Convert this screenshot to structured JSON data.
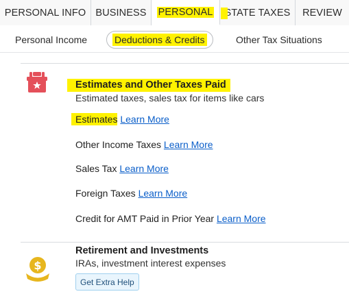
{
  "top_tabs": [
    {
      "label": "PERSONAL INFO"
    },
    {
      "label": "BUSINESS"
    },
    {
      "label": "PERSONAL"
    },
    {
      "label": "STATE TAXES"
    },
    {
      "label": "REVIEW"
    }
  ],
  "sub_tabs": [
    {
      "label": "Personal Income"
    },
    {
      "label": "Deductions & Credits"
    },
    {
      "label": "Other Tax Situations"
    }
  ],
  "section1": {
    "title": "Estimates and Other Taxes Paid",
    "description": "Estimated taxes, sales tax for items like cars",
    "items": [
      {
        "label": "Estimates",
        "link": "Learn More"
      },
      {
        "label": "Other Income Taxes",
        "link": "Learn More"
      },
      {
        "label": "Sales Tax",
        "link": "Learn More"
      },
      {
        "label": "Foreign Taxes",
        "link": "Learn More"
      },
      {
        "label": "Credit for AMT Paid in Prior Year",
        "link": "Learn More"
      }
    ]
  },
  "section2": {
    "title": "Retirement and Investments",
    "description": "IRAs, investment interest expenses",
    "help_label": "Get Extra Help"
  },
  "colors": {
    "highlight": "#fff200",
    "link": "#0a5ec9",
    "gift_icon": "#e4505a",
    "coin_icon": "#e7b61e"
  }
}
